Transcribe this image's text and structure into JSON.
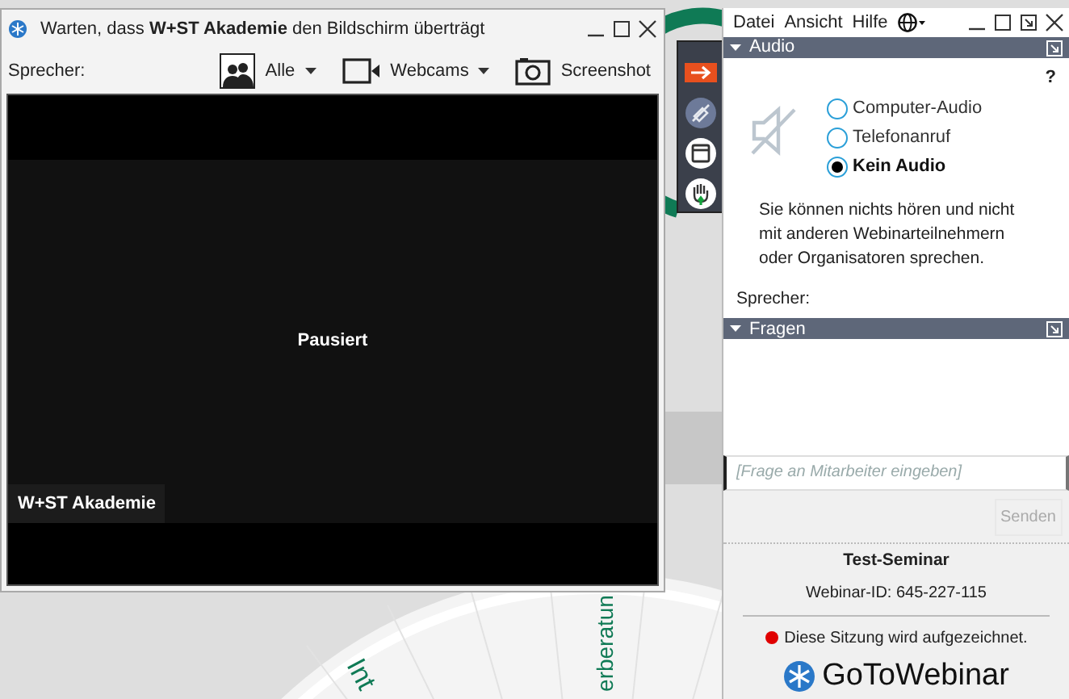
{
  "background": {
    "texts": [
      {
        "text": "erberatun",
        "kind": "vertical"
      },
      {
        "text": "Int",
        "kind": "slanted"
      }
    ]
  },
  "viewer": {
    "title": "Warten, dass **W+ST Akademie** den Bildschirm überträgt",
    "speaker_label": "Sprecher:",
    "toolbar": [
      {
        "kind": "people",
        "label": "Alle",
        "dropdown": true
      },
      {
        "kind": "webcam",
        "label": "Webcams",
        "dropdown": true
      },
      {
        "kind": "camera",
        "label": "Screenshot",
        "dropdown": false
      }
    ],
    "status": "Pausiert",
    "presenter": "W+ST Akademie"
  },
  "side_toolbar": [
    {
      "kind": "arrow"
    },
    {
      "kind": "mute"
    },
    {
      "kind": "window"
    },
    {
      "kind": "hand"
    }
  ],
  "panel": {
    "menu": [
      "Datei",
      "Ansicht",
      "Hilfe"
    ],
    "audio": {
      "title": "Audio",
      "expanded": true,
      "help": "?",
      "options": [
        {
          "label": "Computer-Audio",
          "selected": false
        },
        {
          "label": "Telefonanruf",
          "selected": false
        },
        {
          "label": "Kein Audio",
          "selected": true
        }
      ],
      "message": "Sie können nichts hören und nicht mit anderen Webinarteilnehmern oder Organisatoren sprechen.",
      "speaker_label": "Sprecher:"
    },
    "questions": {
      "title": "Fragen",
      "expanded": true,
      "placeholder": "[Frage an Mitarbeiter eingeben]",
      "send": "Senden",
      "send_disabled": true
    },
    "footer": {
      "name": "Test-Seminar",
      "id": "Webinar-ID: 645-227-115",
      "recording": "Diese Sitzung wird aufgezeichnet.",
      "brand": "**GoTo**Webinar"
    }
  }
}
